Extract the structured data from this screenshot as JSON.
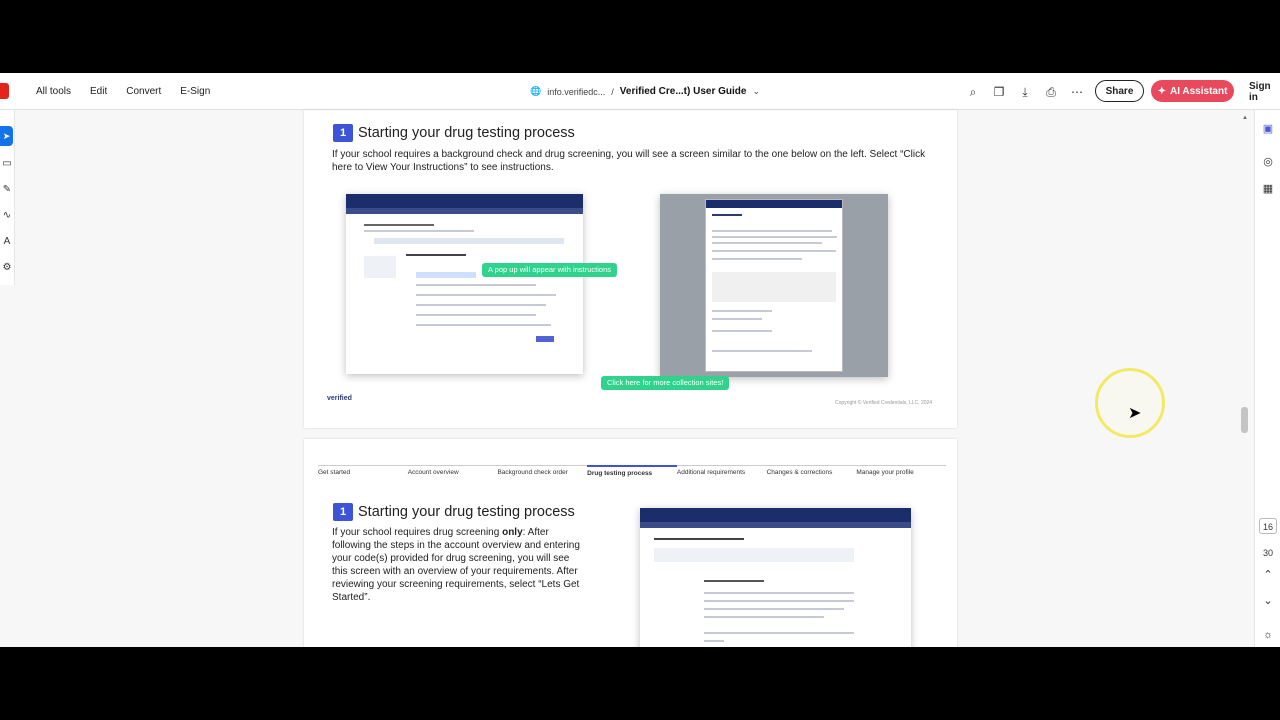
{
  "toolbar": {
    "menu": [
      "All tools",
      "Edit",
      "Convert",
      "E-Sign"
    ],
    "breadcrumb_site": "info.verifiedc...",
    "breadcrumb_sep": "/",
    "doc_title": "Verified Cre...t) User Guide",
    "share_label": "Share",
    "ai_label": "AI Assistant",
    "signin_label": "Sign in"
  },
  "pager": {
    "current": "16",
    "total": "30"
  },
  "page1": {
    "step_number": "1",
    "title": "Starting your drug testing process",
    "body": "If your school requires a background check and drug screening, you will see a screen similar to the one below on the left. Select “Click here to View Your Instructions” to see instructions.",
    "callout_popup": "A pop up will appear with instructions",
    "callout_sites": "Click here for more collection sites!",
    "footer_logo": "verified",
    "copyright": "Copyright © Verified Credentials, LLC, 2024"
  },
  "page2": {
    "tabs": [
      "Get started",
      "Account overview",
      "Background check order",
      "Drug testing process",
      "Additional requirements",
      "Changes & corrections",
      "Manage your profile"
    ],
    "active_tab": 3,
    "step_number": "1",
    "title": "Starting your drug testing process",
    "body_pre": "If your school requires drug screening ",
    "body_bold": "only",
    "body_post": ": After following the steps in the account overview and entering your code(s) provided for drug screening, you will see this screen with an overview of your requirements. After reviewing your screening requirements, select “Lets Get Started”."
  },
  "icons": {
    "search": "search-icon",
    "pages": "page-thumbnails-icon",
    "download": "download-icon",
    "print": "print-icon",
    "more": "more-icon",
    "globe": "globe-icon"
  }
}
